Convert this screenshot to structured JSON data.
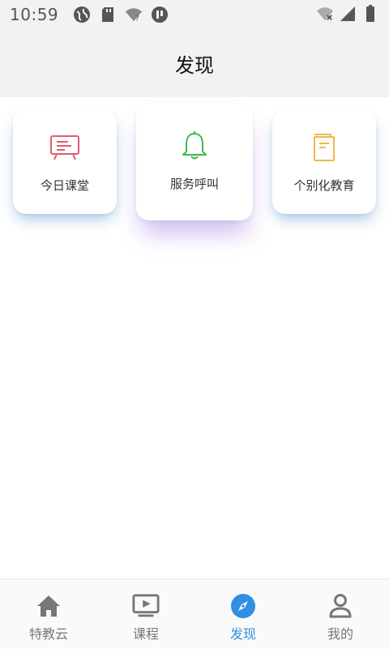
{
  "status_bar": {
    "time": "10:59",
    "left_icons": [
      "globe-icon",
      "sd-card-icon",
      "wifi-unknown-icon",
      "app-notification-icon"
    ],
    "right_icons": [
      "wifi-off-icon",
      "signal-icon",
      "battery-icon"
    ]
  },
  "header": {
    "title": "发现"
  },
  "cards": [
    {
      "label": "今日课堂",
      "icon": "presentation-board-icon",
      "color": "#e25b6b"
    },
    {
      "label": "服务呼叫",
      "icon": "bell-icon",
      "color": "#3fb950"
    },
    {
      "label": "个别化教育",
      "icon": "book-icon",
      "color": "#f0b84a"
    }
  ],
  "bottom_nav": {
    "active_color": "#2f8fe3",
    "inactive_color": "#777777",
    "items": [
      {
        "label": "特教云",
        "icon": "home-icon",
        "active": false
      },
      {
        "label": "课程",
        "icon": "video-play-icon",
        "active": false
      },
      {
        "label": "发现",
        "icon": "compass-icon",
        "active": true
      },
      {
        "label": "我的",
        "icon": "user-icon",
        "active": false
      }
    ]
  }
}
